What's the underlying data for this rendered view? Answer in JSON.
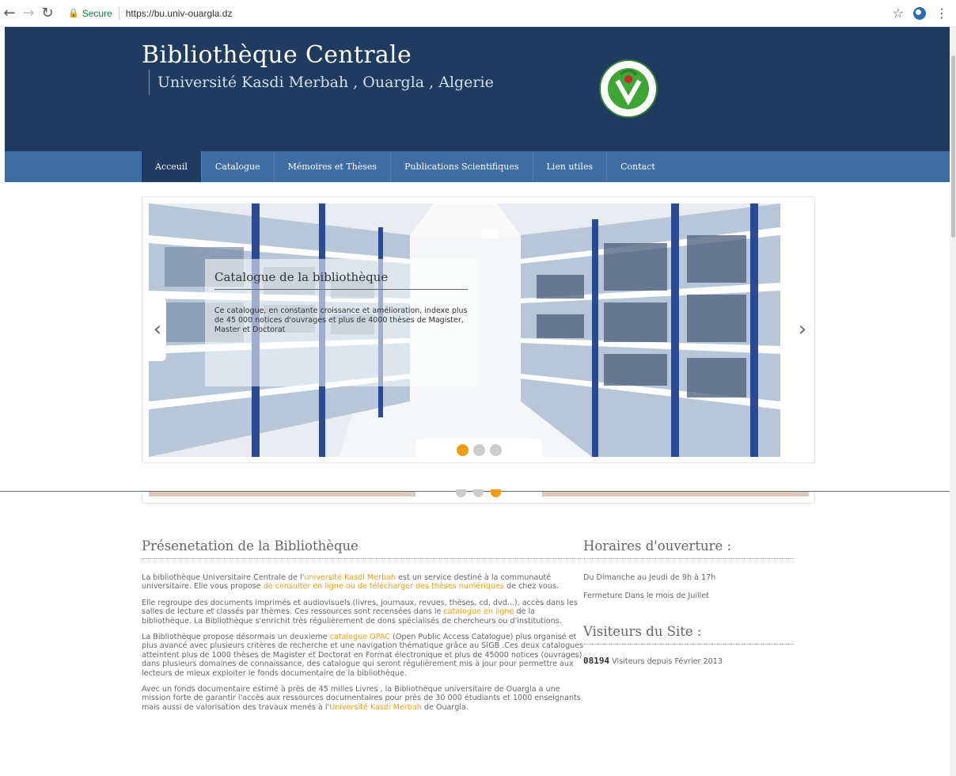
{
  "browser": {
    "secure_label": "Secure",
    "url": "https://bu.univ-ouargla.dz"
  },
  "header": {
    "title": "Bibliothèque Centrale",
    "subtitle": "Université Kasdi Merbah , Ouargla , Algerie"
  },
  "menu": {
    "items": [
      "Acceuil",
      "Catalogue",
      "Mémoires et Thèses",
      "Publications Scientifiques",
      "Lien utiles",
      "Contact"
    ]
  },
  "slider": {
    "caption_title": "Catalogue de la bibliothèque",
    "caption_text": "Ce catalogue, en constante croissance et amélioration, indexe plus de 45 000 notices d'ouvrages et plus de 4000 thèses de Magister, Master et Doctorat",
    "active_dot": 1,
    "dot_count": 3
  },
  "presentation": {
    "title": "Présenetation de la Bibliothèque",
    "p1_a": "La bibliothèque Universitaire Centrale de l'",
    "p1_link1": "université Kasdi Merbah",
    "p1_b": " est un service destiné à la communauté universitaire. Elle vous propose ",
    "p1_link2": "de consulter en ligne ou de télécharger des thèses numériques",
    "p1_c": " de chez vous.",
    "p2_a": "Elle regroupe des documents imprimés et audiovisuels (livres, journaux, revues, thèses, cd, dvd...), accès dans les salles de lecture et classés par thèmes. Ces ressources sont recensées dans le ",
    "p2_link": "catalogue en ligne",
    "p2_b": " de la bibliothèque. La Bibliothèque s'enrichit très régulièrement de dons spécialisés de chercheurs ou d'institutions.",
    "p3_a": "La Bibliothèque propose désormais un deuxieme  ",
    "p3_link": "catalogue OPAC",
    "p3_b": " (Open Public Access Catalogue)  plus organisé et plus avancé avec plusieurs critères de recherche et une navigation thématique grâce au SIGB .Ces deux catalogues atteintent plus de 1000 thèses de Magister et Doctorat en Format électronique et plus de 45000 notices (ouvrages) dans plusieurs domaines de connaissance, des catalogue qui seront régulièrement mis à jour pour  permettre aux lecteurs de mieux exploiter le fonds documentaire de la bibliothèque.",
    "p4_a": "Avec un fonds documentaire estimé à près de 45 milles Livres , la Bibliothèque universitaire de Ouargla a une mission forte de garantir l'accès aux ressources documentaires pour près de 30 000 étudiants et 1000 enseignants mais aussi de valorisation des travaux menés à l'",
    "p4_link": "Université Kasdi Merbah",
    "p4_b": " de Ouargla."
  },
  "hours": {
    "title": "Horaires d'ouverture :",
    "line1": "Du Dimanche au Jeudi de 9h à 17h",
    "line2": "Fermeture Dans le mois de Juillet"
  },
  "visitors": {
    "title": "Visiteurs du Site :",
    "count": "08194",
    "text": " Visiteurs depuis Février 2013"
  },
  "colors": {
    "header_bg": "#1f3b60",
    "menu_bg": "#3e6da4",
    "accent": "#f39c12"
  }
}
